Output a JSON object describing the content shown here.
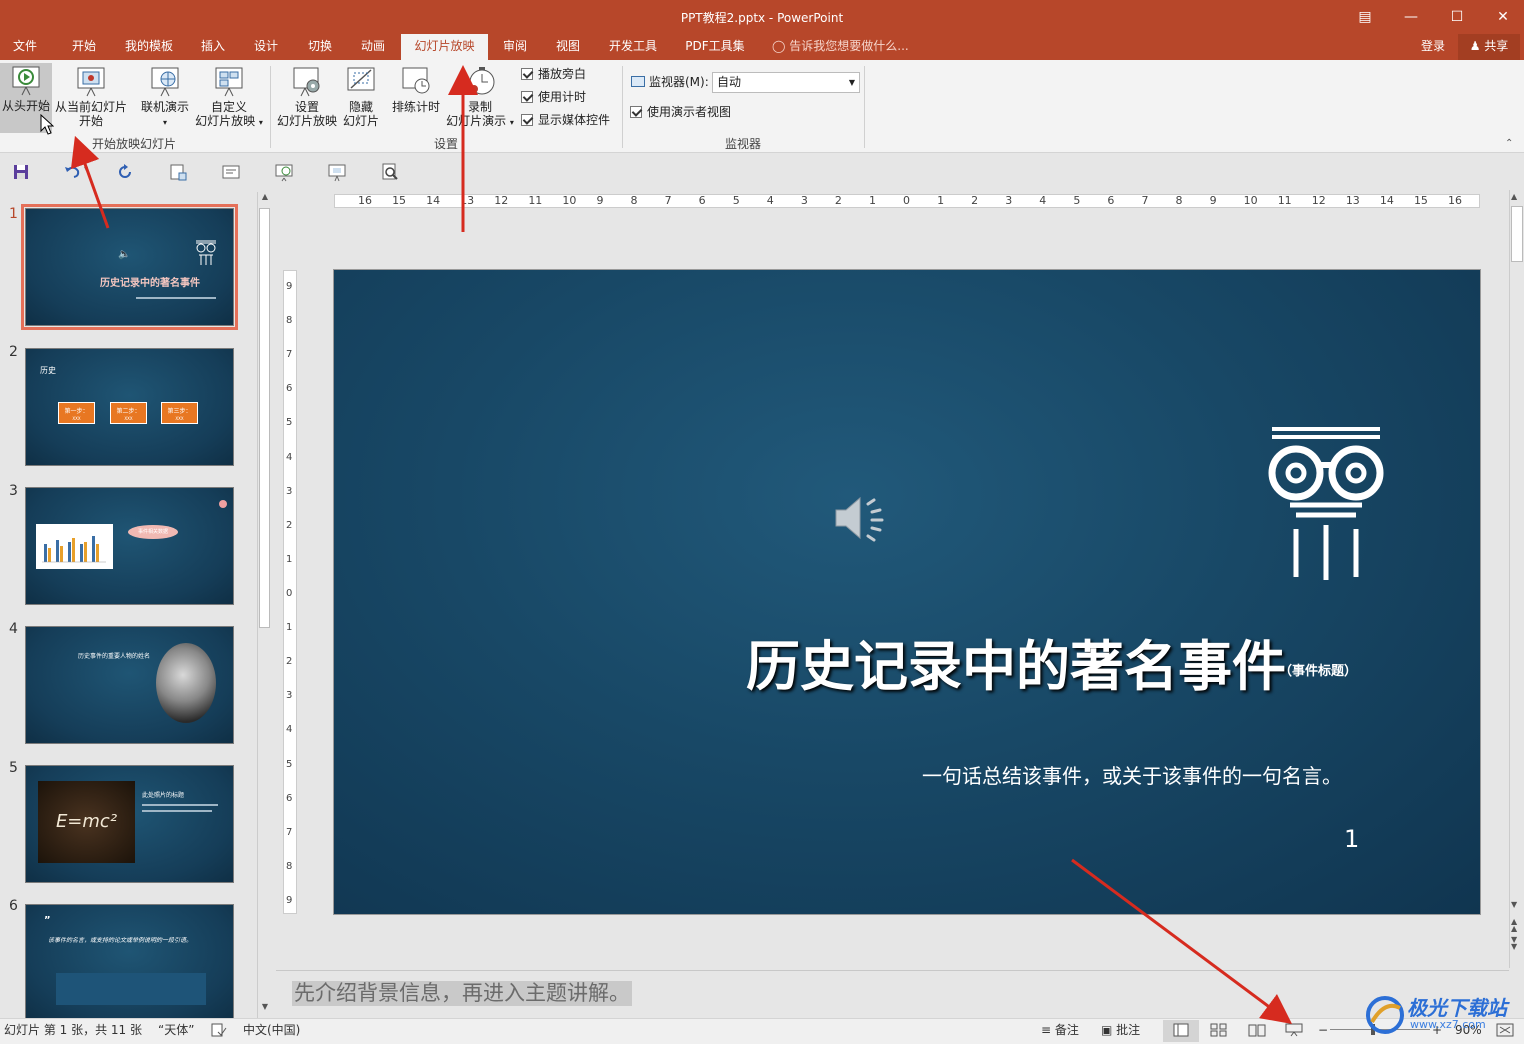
{
  "window": {
    "title": "PPT教程2.pptx - PowerPoint"
  },
  "tabs": [
    {
      "label": "文件"
    },
    {
      "label": "开始"
    },
    {
      "label": "我的模板"
    },
    {
      "label": "插入"
    },
    {
      "label": "设计"
    },
    {
      "label": "切换"
    },
    {
      "label": "动画"
    },
    {
      "label": "幻灯片放映",
      "active": true
    },
    {
      "label": "审阅"
    },
    {
      "label": "视图"
    },
    {
      "label": "开发工具"
    },
    {
      "label": "PDF工具集"
    }
  ],
  "tell_me": "告诉我您想要做什么...",
  "account": {
    "login": "登录",
    "share": "共享"
  },
  "ribbon": {
    "start_group": {
      "label": "开始放映幻灯片",
      "from_beginning": "从头开始",
      "from_current_1": "从当前幻灯片",
      "from_current_2": "开始",
      "online": "联机演示",
      "custom_1": "自定义",
      "custom_2": "幻灯片放映"
    },
    "setup_group": {
      "label": "设置",
      "setup_1": "设置",
      "setup_2": "幻灯片放映",
      "hide_1": "隐藏",
      "hide_2": "幻灯片",
      "rehearse": "排练计时",
      "record_1": "录制",
      "record_2": "幻灯片演示",
      "chk_narration": "播放旁白",
      "chk_timings": "使用计时",
      "chk_media": "显示媒体控件"
    },
    "monitor_group": {
      "label": "监视器",
      "monitor_label": "监视器(M):",
      "monitor_value": "自动",
      "presenter_view": "使用演示者视图"
    }
  },
  "thumbnails": [
    {
      "num": "1",
      "title": "历史记录中的著名事件"
    },
    {
      "num": "2",
      "title": "历史",
      "step1": "第一步：",
      "step2": "第二步：",
      "step3": "第三步：",
      "step_sub": "XXX"
    },
    {
      "num": "3",
      "bubble": "事件相关数据"
    },
    {
      "num": "4",
      "title": "历史事件的重要人物的姓名"
    },
    {
      "num": "5",
      "title": "此处照片的标题",
      "formula": "E=mc²"
    },
    {
      "num": "6",
      "quote": "该事件的名言，或支持的论文或举例说明的一段引语。"
    }
  ],
  "ruler": {
    "h_ticks": [
      "16",
      "15",
      "14",
      "13",
      "12",
      "11",
      "10",
      "9",
      "8",
      "7",
      "6",
      "5",
      "4",
      "3",
      "2",
      "1",
      "0",
      "1",
      "2",
      "3",
      "4",
      "5",
      "6",
      "7",
      "8",
      "9",
      "10",
      "11",
      "12",
      "13",
      "14",
      "15",
      "16"
    ],
    "v_ticks": [
      "9",
      "8",
      "7",
      "6",
      "5",
      "4",
      "3",
      "2",
      "1",
      "0",
      "1",
      "2",
      "3",
      "4",
      "5",
      "6",
      "7",
      "8",
      "9"
    ]
  },
  "slide": {
    "title": "历史记录中的著名事件",
    "subtitle": "（事件标题）",
    "quote": "一句话总结该事件，或关于该事件的一句名言。",
    "number": "1"
  },
  "notes": "先介绍背景信息，再进入主题讲解。",
  "status": {
    "slide_info": "幻灯片 第 1 张，共 11 张",
    "theme": "“天体”",
    "language": "中文(中国)",
    "notes_btn": "备注",
    "comments_btn": "批注",
    "zoom": "90%"
  },
  "watermark": {
    "text": "极光下载站",
    "url": "www.xz7.com"
  },
  "colors": {
    "accent": "#b7472a",
    "slide_bg": "#184866",
    "arrow": "#d62b1f"
  }
}
